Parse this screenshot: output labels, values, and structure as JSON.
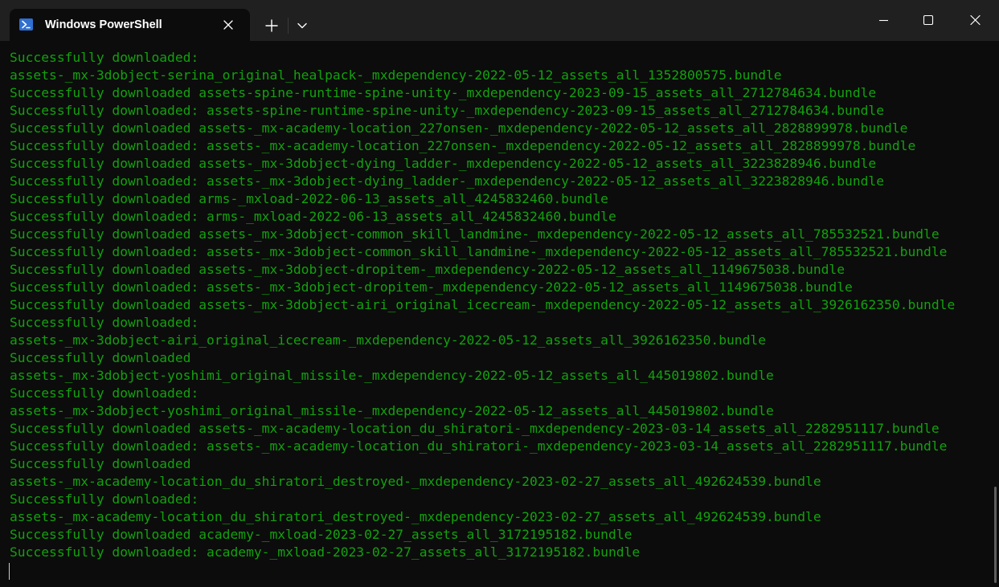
{
  "window": {
    "tab_title": "Windows PowerShell",
    "controls": {
      "new_tab_icon": "plus-icon",
      "dropdown_icon": "chevron-down-icon",
      "minimize_icon": "minimize-icon",
      "maximize_icon": "maximize-icon",
      "close_icon": "close-icon"
    }
  },
  "colors": {
    "terminal_bg": "#0c0c0c",
    "titlebar_bg": "#202020",
    "output_text": "#13a10e",
    "powershell_icon": "#2f6fd1"
  },
  "terminal": {
    "lines": [
      "Successfully downloaded:",
      "assets-_mx-3dobject-serina_original_healpack-_mxdependency-2022-05-12_assets_all_1352800575.bundle",
      "Successfully downloaded assets-spine-runtime-spine-unity-_mxdependency-2023-09-15_assets_all_2712784634.bundle",
      "Successfully downloaded: assets-spine-runtime-spine-unity-_mxdependency-2023-09-15_assets_all_2712784634.bundle",
      "Successfully downloaded assets-_mx-academy-location_227onsen-_mxdependency-2022-05-12_assets_all_2828899978.bundle",
      "Successfully downloaded: assets-_mx-academy-location_227onsen-_mxdependency-2022-05-12_assets_all_2828899978.bundle",
      "Successfully downloaded assets-_mx-3dobject-dying_ladder-_mxdependency-2022-05-12_assets_all_3223828946.bundle",
      "Successfully downloaded: assets-_mx-3dobject-dying_ladder-_mxdependency-2022-05-12_assets_all_3223828946.bundle",
      "Successfully downloaded arms-_mxload-2022-06-13_assets_all_4245832460.bundle",
      "Successfully downloaded: arms-_mxload-2022-06-13_assets_all_4245832460.bundle",
      "Successfully downloaded assets-_mx-3dobject-common_skill_landmine-_mxdependency-2022-05-12_assets_all_785532521.bundle",
      "Successfully downloaded: assets-_mx-3dobject-common_skill_landmine-_mxdependency-2022-05-12_assets_all_785532521.bundle",
      "Successfully downloaded assets-_mx-3dobject-dropitem-_mxdependency-2022-05-12_assets_all_1149675038.bundle",
      "Successfully downloaded: assets-_mx-3dobject-dropitem-_mxdependency-2022-05-12_assets_all_1149675038.bundle",
      "Successfully downloaded assets-_mx-3dobject-airi_original_icecream-_mxdependency-2022-05-12_assets_all_3926162350.bundle",
      "Successfully downloaded:",
      "assets-_mx-3dobject-airi_original_icecream-_mxdependency-2022-05-12_assets_all_3926162350.bundle",
      "Successfully downloaded",
      "assets-_mx-3dobject-yoshimi_original_missile-_mxdependency-2022-05-12_assets_all_445019802.bundle",
      "Successfully downloaded:",
      "assets-_mx-3dobject-yoshimi_original_missile-_mxdependency-2022-05-12_assets_all_445019802.bundle",
      "Successfully downloaded assets-_mx-academy-location_du_shiratori-_mxdependency-2023-03-14_assets_all_2282951117.bundle",
      "Successfully downloaded: assets-_mx-academy-location_du_shiratori-_mxdependency-2023-03-14_assets_all_2282951117.bundle",
      "Successfully downloaded",
      "assets-_mx-academy-location_du_shiratori_destroyed-_mxdependency-2023-02-27_assets_all_492624539.bundle",
      "Successfully downloaded:",
      "assets-_mx-academy-location_du_shiratori_destroyed-_mxdependency-2023-02-27_assets_all_492624539.bundle",
      "Successfully downloaded academy-_mxload-2023-02-27_assets_all_3172195182.bundle",
      "Successfully downloaded: academy-_mxload-2023-02-27_assets_all_3172195182.bundle"
    ]
  }
}
